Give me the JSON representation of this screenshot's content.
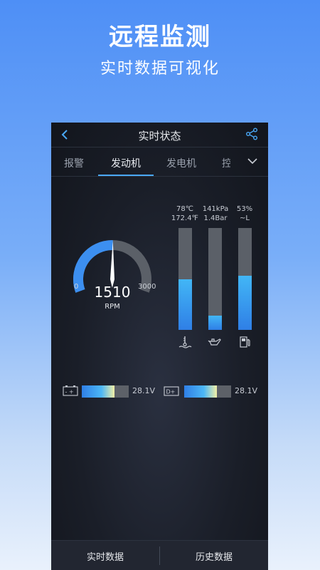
{
  "promo": {
    "title": "远程监测",
    "subtitle": "实时数据可视化"
  },
  "nav": {
    "title": "实时状态",
    "back_icon": "chevron-left-icon",
    "share_icon": "share-icon"
  },
  "tabs": [
    {
      "label": "报警",
      "active": false
    },
    {
      "label": "发动机",
      "active": true
    },
    {
      "label": "发电机",
      "active": false
    },
    {
      "label": "控",
      "active": false
    }
  ],
  "tabs_more_icon": "chevron-down-icon",
  "gauge": {
    "value": "1510",
    "unit": "RPM",
    "min": "0",
    "max": "3000",
    "value_num": 1510,
    "min_num": 0,
    "max_num": 3000
  },
  "meters": [
    {
      "name": "coolant-temperature",
      "line1": "78℃",
      "line2": "172.4℉",
      "level": 0.5,
      "icon": "coolant-temp-icon"
    },
    {
      "name": "oil-pressure",
      "line1": "141kPa",
      "line2": "1.4Bar",
      "level": 0.14,
      "icon": "oil-can-icon"
    },
    {
      "name": "fuel-level",
      "line1": "53%",
      "line2": "~L",
      "level": 0.53,
      "icon": "fuel-pump-icon"
    }
  ],
  "voltages": [
    {
      "name": "battery",
      "label": "- +",
      "value": "28.1V",
      "level": 0.7,
      "icon": "battery-icon"
    },
    {
      "name": "generator",
      "label": "D+",
      "value": "28.1V",
      "level": 0.7,
      "icon": "alternator-icon"
    }
  ],
  "bottom": {
    "left": "实时数据",
    "right": "历史数据"
  },
  "colors": {
    "accent": "#4aa8f5",
    "track": "#5b6068",
    "panel": "#1a1e28"
  }
}
